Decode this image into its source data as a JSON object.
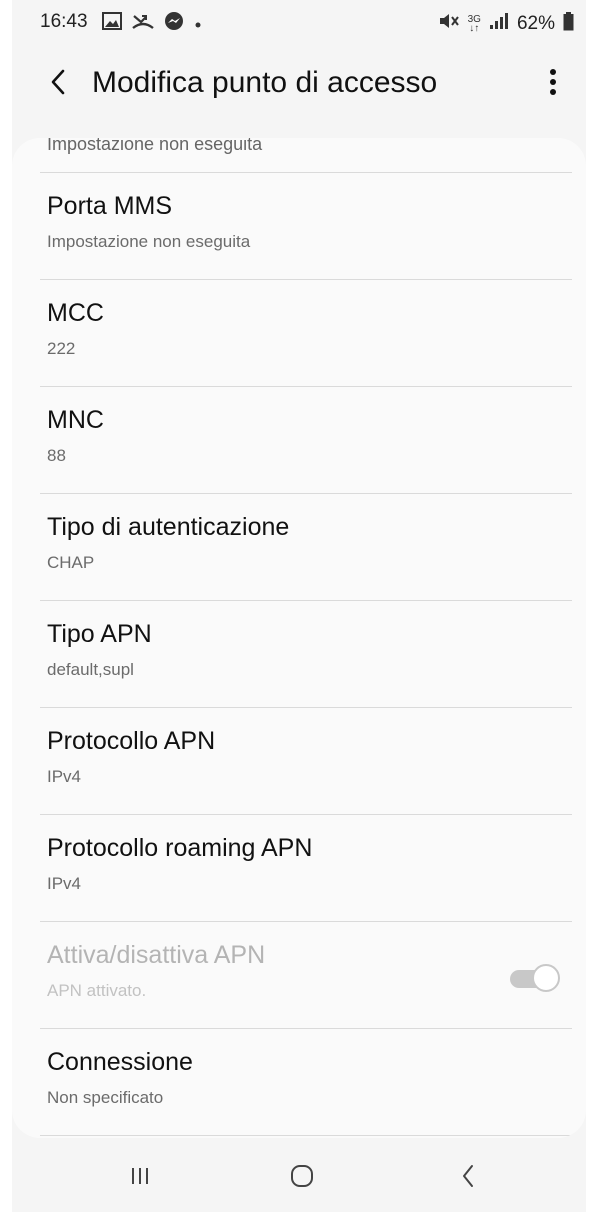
{
  "status_bar": {
    "time": "16:43",
    "left_icons": [
      "gallery-icon",
      "missed-call-icon",
      "messenger-icon",
      "dot-icon"
    ],
    "right_icons": [
      "mute-icon",
      "network-3g-icon",
      "signal-icon",
      "battery-icon"
    ],
    "network": "3G",
    "battery": "62%"
  },
  "app_bar": {
    "title": "Modifica punto di accesso",
    "back_icon": "chevron-left-icon",
    "more_icon": "more-vert-icon"
  },
  "list": {
    "cut_off_text": "Impostazione non eseguita",
    "items": [
      {
        "title": "Porta MMS",
        "subtitle": "Impostazione non eseguita"
      },
      {
        "title": "MCC",
        "subtitle": "222"
      },
      {
        "title": "MNC",
        "subtitle": "88"
      },
      {
        "title": "Tipo di autenticazione",
        "subtitle": "CHAP"
      },
      {
        "title": "Tipo APN",
        "subtitle": "default,supl"
      },
      {
        "title": "Protocollo APN",
        "subtitle": "IPv4"
      },
      {
        "title": "Protocollo roaming APN",
        "subtitle": "IPv4"
      },
      {
        "title": "Attiva/disattiva APN",
        "subtitle": "APN attivato.",
        "toggle_on": true,
        "disabled": true
      },
      {
        "title": "Connessione",
        "subtitle": "Non specificato"
      }
    ]
  },
  "nav_bar": {
    "icons": [
      "recents-icon",
      "home-icon",
      "back-icon"
    ]
  },
  "colors": {
    "background": "#f5f5f5",
    "card": "#fafafa",
    "divider": "#dadada",
    "disabled_text": "#b4b4b4"
  }
}
